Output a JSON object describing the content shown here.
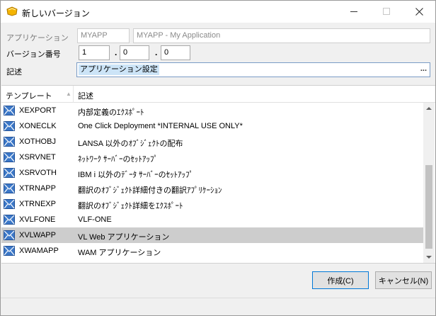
{
  "window": {
    "title": "新しいバージョン"
  },
  "form": {
    "application_label": "アプリケーション",
    "application_code": "MYAPP",
    "application_name": "MYAPP - My Application",
    "version_label": "バージョン番号",
    "version_major": "1",
    "version_minor": "0",
    "version_patch": "0",
    "version_sep": ".",
    "description_label": "記述",
    "description_value": "アプリケーション設定",
    "description_button": "..."
  },
  "list": {
    "col_template": "テンプレート",
    "col_description": "記述",
    "rows": [
      {
        "name": "XEXPORT",
        "desc": "内部定義のｴｸｽﾎﾟｰﾄ"
      },
      {
        "name": "XONECLK",
        "desc": "One Click Deployment *INTERNAL USE ONLY*"
      },
      {
        "name": "XOTHOBJ",
        "desc": "LANSA 以外のｵﾌﾞｼﾞｪｸﾄの配布"
      },
      {
        "name": "XSRVNET",
        "desc": "ﾈｯﾄﾜｰｸ ｻｰﾊﾞｰのｾｯﾄｱｯﾌﾟ"
      },
      {
        "name": "XSRVOTH",
        "desc": "IBM i 以外のﾃﾞｰﾀ ｻｰﾊﾞｰのｾｯﾄｱｯﾌﾟ"
      },
      {
        "name": "XTRNAPP",
        "desc": "翻訳のｵﾌﾞｼﾞｪｸﾄ詳細付きの翻訳ｱﾌﾟﾘｹｰｼｮﾝ"
      },
      {
        "name": "XTRNEXP",
        "desc": "翻訳のｵﾌﾞｼﾞｪｸﾄ詳細をｴｸｽﾎﾟｰﾄ"
      },
      {
        "name": "XVLFONE",
        "desc": "VLF-ONE"
      },
      {
        "name": "XVLWAPP",
        "desc": "VL Web アプリケーション",
        "selected": true
      },
      {
        "name": "XWAMAPP",
        "desc": "WAM アプリケーション"
      }
    ]
  },
  "buttons": {
    "ok": "作成(C)",
    "cancel": "キャンセル(N)"
  },
  "colors": {
    "selection": "#cdcdcd",
    "text_highlight": "#cce4f7",
    "default_button_border": "#0078d7"
  }
}
